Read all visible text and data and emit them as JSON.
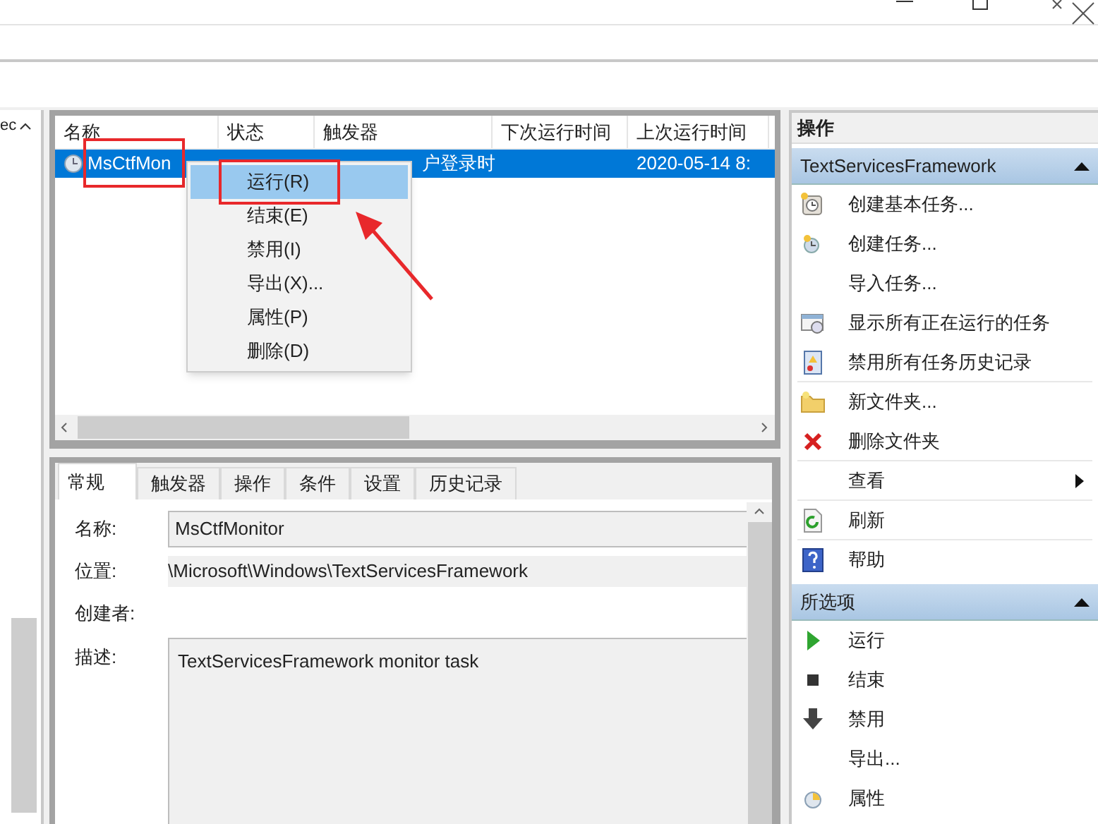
{
  "tree_panel": {
    "text": "ec"
  },
  "task_list": {
    "columns": [
      "名称",
      "状态",
      "触发器",
      "下次运行时间",
      "上次运行时间"
    ],
    "rows": [
      {
        "name": "MsCtfMon",
        "trigger": "户登录时",
        "last_run": "2020-05-14 8:",
        "selected": true,
        "name_highlighted": true
      }
    ]
  },
  "context_menu": {
    "items": [
      {
        "label": "运行(R)",
        "selected": true,
        "highlighted": true
      },
      {
        "label": "结束(E)",
        "selected": false,
        "highlighted": false
      },
      {
        "label": "禁用(I)",
        "selected": false,
        "highlighted": false
      },
      {
        "label": "导出(X)...",
        "selected": false,
        "highlighted": false
      },
      {
        "label": "属性(P)",
        "selected": false,
        "highlighted": false
      },
      {
        "label": "删除(D)",
        "selected": false,
        "highlighted": false
      }
    ]
  },
  "detail": {
    "tabs": [
      {
        "label": "常规",
        "selected": true
      },
      {
        "label": "触发器",
        "selected": false
      },
      {
        "label": "操作",
        "selected": false
      },
      {
        "label": "条件",
        "selected": false
      },
      {
        "label": "设置",
        "selected": false
      },
      {
        "label": "历史记录",
        "selected": false
      }
    ],
    "fields": [
      {
        "kind": "input",
        "label": "名称:",
        "value": "MsCtfMonitor"
      },
      {
        "kind": "text",
        "label": "位置:",
        "value": "\\Microsoft\\Windows\\TextServicesFramework"
      },
      {
        "kind": "text",
        "label": "创建者:"
      },
      {
        "kind": "textarea",
        "label": "描述:",
        "value": "TextServicesFramework monitor task"
      }
    ]
  },
  "actions_panel": {
    "title": "操作",
    "sections": [
      {
        "title": "TextServicesFramework",
        "expanded": true,
        "items": [
          {
            "label": "创建基本任务..."
          },
          {
            "label": "创建任务..."
          },
          {
            "label": "导入任务..."
          },
          {
            "label": "显示所有正在运行的任务"
          },
          {
            "label": "禁用所有任务历史记录",
            "separator_after": true
          },
          {
            "label": "新文件夹..."
          },
          {
            "label": "删除文件夹",
            "separator_after": true
          },
          {
            "label": "查看",
            "submenu": true,
            "separator_after": true
          },
          {
            "label": "刷新",
            "separator_after": true
          },
          {
            "label": "帮助"
          }
        ]
      },
      {
        "title": "所选项",
        "expanded": true,
        "items": [
          {
            "label": "运行"
          },
          {
            "label": "结束"
          },
          {
            "label": "禁用"
          },
          {
            "label": "导出..."
          },
          {
            "label": "属性"
          }
        ]
      }
    ]
  }
}
